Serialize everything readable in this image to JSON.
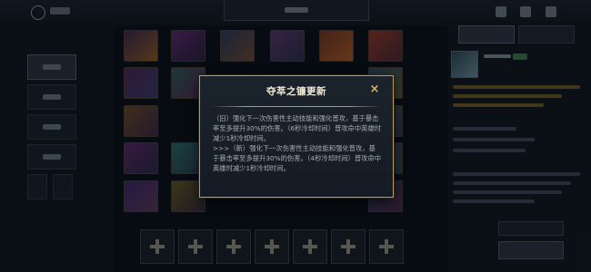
{
  "dialog": {
    "title": "夺萃之镰更新",
    "close_icon": "×",
    "paragraphs": [
      "（旧）强化下一次伤害性主动技能和强化普攻，基于暴击率至多提升30%的伤害。（6秒冷却时间）普攻命中英雄时减少1秒冷却时间。",
      ">>>（新）强化下一次伤害性主动技能和强化普攻，基于暴击率至多提升30%的伤害。（4秒冷却时间）普攻命中英雄时减少1秒冷却时间。"
    ]
  },
  "colors": {
    "dialog_border": "#b79a62",
    "title_text": "#f2ead8",
    "body_text": "#a8aeb4",
    "close_icon": "#d6b46a"
  }
}
